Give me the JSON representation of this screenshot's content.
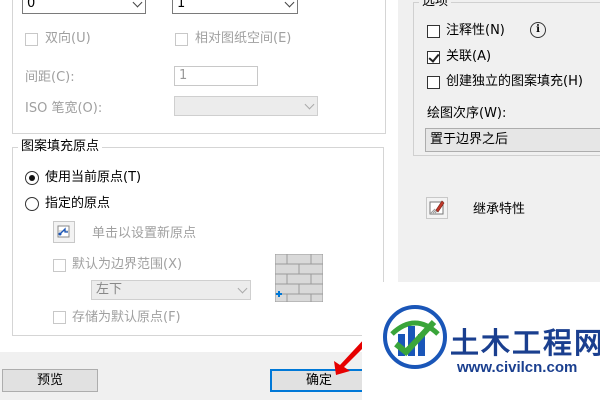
{
  "pattern": {
    "angle_value": "0",
    "scale_value": "1",
    "double_label": "双向(U)",
    "relative_paper_label": "相对图纸空间(E)",
    "spacing_label": "间距(C):",
    "spacing_value": "1",
    "iso_pen_label": "ISO 笔宽(O):",
    "iso_pen_value": ""
  },
  "origin": {
    "group_title": "图案填充原点",
    "use_current_label": "使用当前原点(T)",
    "specified_label": "指定的原点",
    "click_set_label": "单击以设置新原点",
    "default_extent_label": "默认为边界范围(X)",
    "extent_value": "左下",
    "store_default_label": "存储为默认原点(F)"
  },
  "options": {
    "group_title": "选项",
    "annotative_label": "注释性(N)",
    "associative_label": "关联(A)",
    "associative_checked": true,
    "separate_hatch_label": "创建独立的图案填充(H)",
    "draw_order_label": "绘图次序(W):",
    "draw_order_value": "置于边界之后",
    "inherit_label": "继承特性"
  },
  "buttons": {
    "preview": "预览",
    "ok": "确定"
  },
  "watermark": {
    "title": "土木工程网",
    "url": "www.civilcn.com"
  },
  "colors": {
    "accent": "#0078d7",
    "logo_blue": "#1a56b8",
    "logo_green": "#3aa53a",
    "pointer_red": "#e60000"
  }
}
